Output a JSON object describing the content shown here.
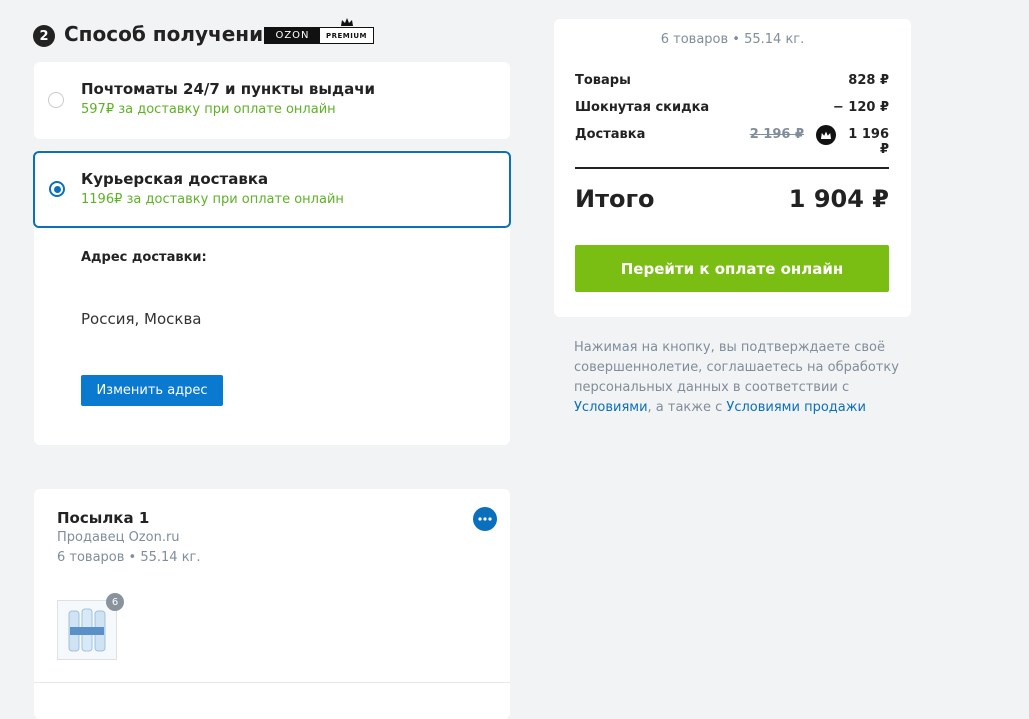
{
  "section": {
    "step": "2",
    "title": "Способ получения",
    "badge_brand": "OZON",
    "badge_premium": "PREMIUM"
  },
  "delivery_options": [
    {
      "title": "Почтоматы 24/7 и пункты выдачи",
      "price_text": "597₽ за доставку при оплате онлайн",
      "selected": false
    },
    {
      "title": "Курьерская доставка",
      "price_text": "1196₽ за доставку при оплате онлайн",
      "selected": true
    }
  ],
  "address": {
    "label": "Адрес доставки:",
    "value": "Россия, Москва",
    "change_button": "Изменить адрес"
  },
  "parcel": {
    "title": "Посылка 1",
    "seller": "Продавец Ozon.ru",
    "summary": "6 товаров • 55.14 кг.",
    "item_count": "6"
  },
  "summary": {
    "caption": "6 товаров • 55.14 кг.",
    "rows": [
      {
        "label": "Товары",
        "value": "828 ₽"
      },
      {
        "label": "Шокнутая скидка",
        "value": "− 120 ₽"
      },
      {
        "label": "Доставка",
        "old_value": "2 196 ₽",
        "value": "1 196 ₽"
      }
    ],
    "total_label": "Итого",
    "total_value": "1 904 ₽",
    "pay_button": "Перейти к оплате онлайн"
  },
  "legal": {
    "text_1": "Нажимая на кнопку, вы подтверждаете своё совершеннолетие, соглашаетесь на обработку персональных данных в соответствии с ",
    "link_1": "Условиями",
    "text_2": ", а также с ",
    "link_2": "Условиями продажи"
  },
  "colors": {
    "accent_blue": "#0a6fbd",
    "accent_green": "#7bbe13",
    "price_green": "#5db225"
  }
}
